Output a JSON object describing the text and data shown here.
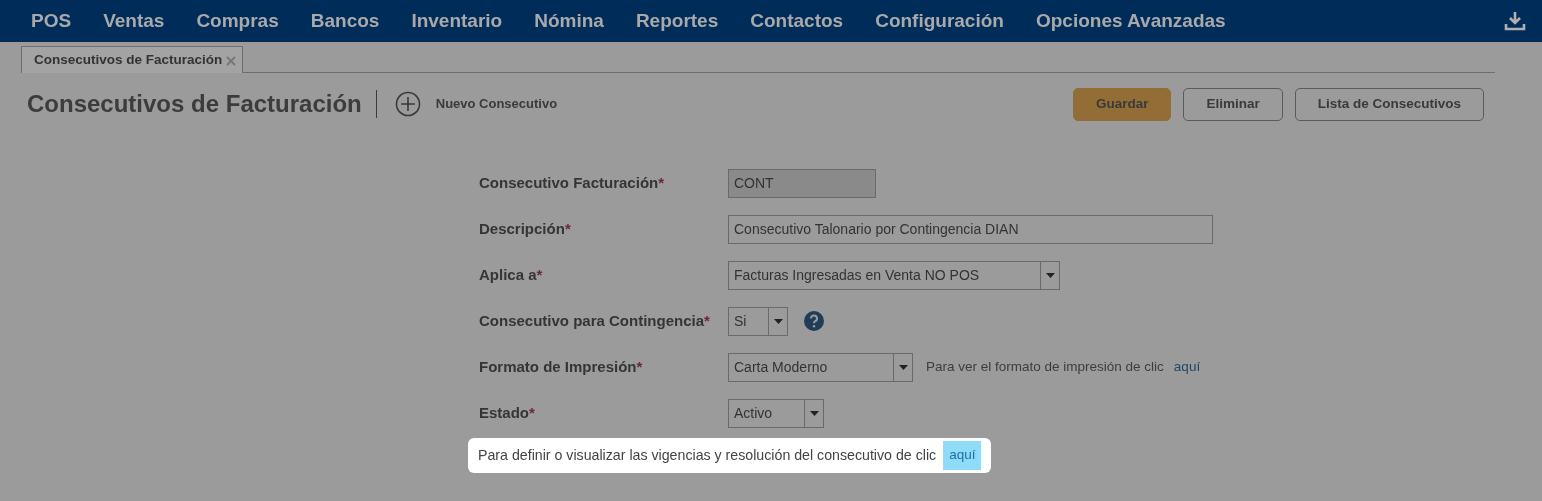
{
  "nav": {
    "items": [
      "POS",
      "Ventas",
      "Compras",
      "Bancos",
      "Inventario",
      "Nómina",
      "Reportes",
      "Contactos",
      "Configuración",
      "Opciones Avanzadas"
    ]
  },
  "tabs": [
    {
      "label": "Consecutivos de Facturación",
      "selected": true
    }
  ],
  "header": {
    "title": "Consecutivos de Facturación",
    "new_label": "Nuevo Consecutivo",
    "buttons": [
      {
        "label": "Guardar",
        "kind": "primary"
      },
      {
        "label": "Eliminar",
        "kind": "outline"
      },
      {
        "label": "Lista de Consecutivos",
        "kind": "outline"
      }
    ]
  },
  "form": {
    "fields": [
      {
        "label": "Consecutivo Facturación",
        "required_mark": "*",
        "kind": "text",
        "value": "CONT",
        "disabled": true
      },
      {
        "label": "Descripción",
        "required_mark": "*",
        "kind": "text",
        "value": "Consecutivo Talonario por Contingencia DIAN",
        "disabled": false
      },
      {
        "label": "Aplica a",
        "required_mark": "*",
        "kind": "select",
        "value": "Facturas Ingresadas en Venta NO POS"
      },
      {
        "label": "Consecutivo para Contingencia",
        "required_mark": "*",
        "kind": "select",
        "value": "Si",
        "help": true
      },
      {
        "label": "Formato de Impresión",
        "required_mark": "*",
        "kind": "select",
        "value": "Carta Moderno",
        "note": "Para ver el formato de impresión de clic",
        "link": "aquí"
      },
      {
        "label": "Estado",
        "required_mark": "*",
        "kind": "select",
        "value": "Activo"
      }
    ]
  },
  "highlight": {
    "text": "Para definir o visualizar las vigencias y resolución del consecutivo de clic",
    "link": "aquí"
  }
}
